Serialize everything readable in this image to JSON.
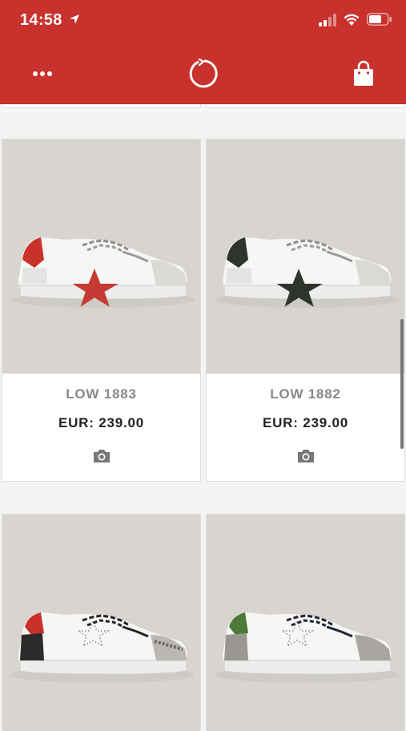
{
  "status": {
    "time": "14:58"
  },
  "header": {
    "background": "#c8312c"
  },
  "products": [
    {
      "name": "LOW 1883",
      "price": "EUR: 239.00",
      "star_color": "#c53a33",
      "heel_color": "#c53a33",
      "icon": "camera-icon"
    },
    {
      "name": "LOW 1882",
      "price": "EUR: 239.00",
      "star_color": "#2f342f",
      "heel_color": "#2f342f",
      "icon": "camera-icon"
    },
    {
      "star_color": "perforated",
      "heel_color": "#c53a33"
    },
    {
      "star_color": "perforated",
      "heel_color": "#4d7a38"
    }
  ]
}
